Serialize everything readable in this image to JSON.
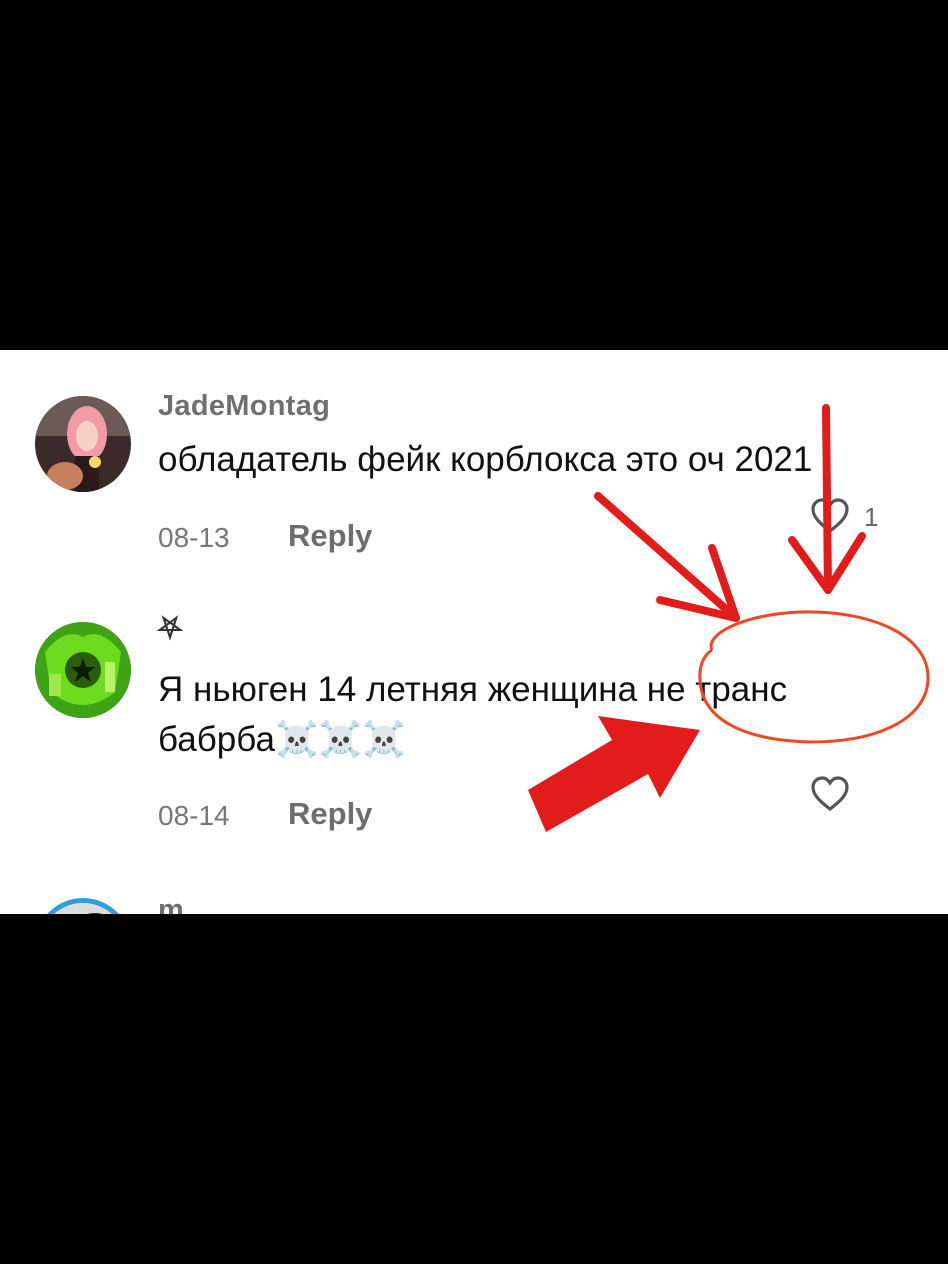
{
  "comments": [
    {
      "username": "JadeMontag",
      "text_line1": "обладатель фейк корблокса это оч 2021",
      "date": "08-13",
      "reply_label": "Reply",
      "likes": "1",
      "avatar_icon": "avatar-photo-pink-hair"
    },
    {
      "username": "⛧",
      "text_line1": "Я ньюген 14 летняя женщина не транс",
      "text_line2": "бабрба",
      "emoji": [
        "☠️",
        "☠️",
        "☠️"
      ],
      "date": "08-14",
      "reply_label": "Reply",
      "avatar_icon": "avatar-green-cat"
    },
    {
      "username": "m",
      "avatar_icon": "avatar-blue-ring"
    }
  ],
  "colors": {
    "background": "#000000",
    "panel": "#ffffff",
    "arrow_red": "#e21b1b",
    "circle_orange": "#f0471e"
  },
  "icons": [
    "heart-outline-icon",
    "red-arrow-annotation",
    "orange-circle-annotation"
  ]
}
